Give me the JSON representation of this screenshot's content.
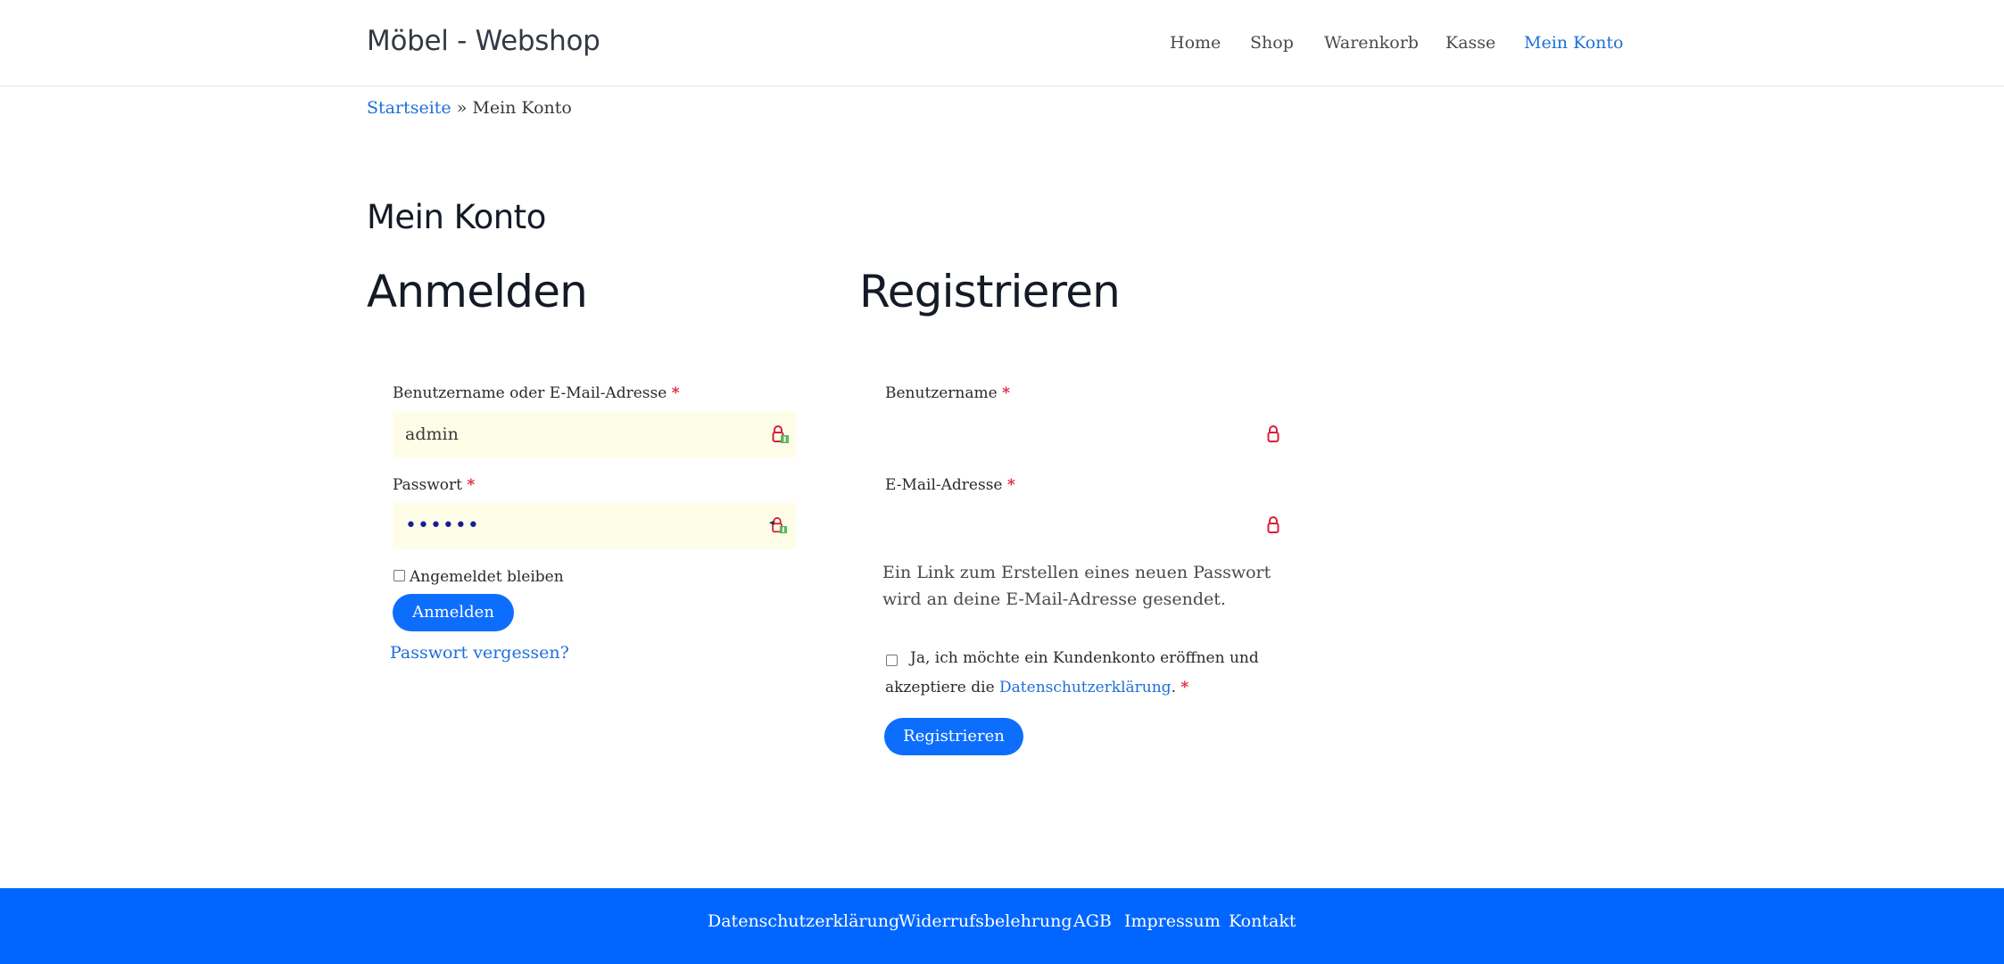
{
  "header": {
    "site_title": "Möbel - Webshop",
    "nav": [
      "Home",
      "Shop",
      "Warenkorb",
      "Kasse",
      "Mein Konto"
    ],
    "active_nav": "Mein Konto"
  },
  "breadcrumb": {
    "home": "Startseite",
    "separator": "»",
    "current": "Mein Konto"
  },
  "page_title": "Mein Konto",
  "login": {
    "heading": "Anmelden",
    "username_label": "Benutzername oder E-Mail-Adresse",
    "username_value": "admin",
    "password_label": "Passwort",
    "password_value": "••••••",
    "remember_label": "Angemeldet bleiben",
    "submit_label": "Anmelden",
    "lost_password": "Passwort vergessen?",
    "required_mark": "*"
  },
  "register": {
    "heading": "Registrieren",
    "username_label": "Benutzername",
    "email_label": "E-Mail-Adresse",
    "note": "Ein Link zum Erstellen eines neuen Passwort wird an deine E-Mail-Adresse gesendet.",
    "consent_text_1": "Ja, ich möchte ein Kundenkonto eröffnen und akzeptiere die",
    "consent_link": "Datenschutzerklärung",
    "consent_text_2": ".",
    "submit_label": "Registrieren",
    "required_mark": "*"
  },
  "footer": {
    "links": [
      "Datenschutzerklärung",
      "Widerrufsbelehrung",
      "AGB",
      "Impressum",
      "Kontakt"
    ]
  },
  "colors": {
    "accent": "#0d6efd",
    "link": "#1e6fd9",
    "footer_bg": "#0066ff",
    "autofill_bg": "#fefee8",
    "required": "#e0203c"
  },
  "icons": {
    "field_lock": "password-manager-lock-icon"
  }
}
